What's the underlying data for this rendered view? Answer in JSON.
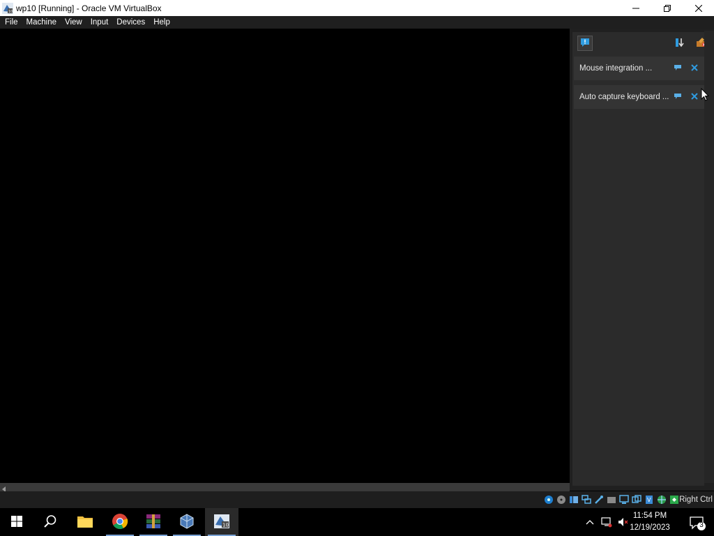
{
  "window": {
    "title": "wp10 [Running] - Oracle VM VirtualBox"
  },
  "menu": {
    "items": [
      "File",
      "Machine",
      "View",
      "Input",
      "Devices",
      "Help"
    ]
  },
  "notifications": {
    "items": [
      {
        "text": "Mouse integration ..."
      },
      {
        "text": "Auto capture keyboard ..."
      }
    ]
  },
  "statusbar": {
    "host_key": "Right Ctrl",
    "icons": [
      "hard-disk-icon",
      "optical-disk-icon",
      "audio-icon",
      "network-icon",
      "usb-icon",
      "shared-folders-icon",
      "display-icon",
      "video-capture-icon",
      "cpu-icon",
      "mouse-integration-icon",
      "keyboard-icon"
    ]
  },
  "taskbar": {
    "apps": [
      "start-button",
      "search-button",
      "file-explorer",
      "chrome",
      "winrar",
      "virtualbox-manager",
      "virtualbox-vm"
    ],
    "time": "11:54 PM",
    "date": "12/19/2023",
    "notification_count": "3"
  },
  "colors": {
    "accent": "#1e90ff",
    "taskbar_indicator": "#7aa3d6"
  }
}
